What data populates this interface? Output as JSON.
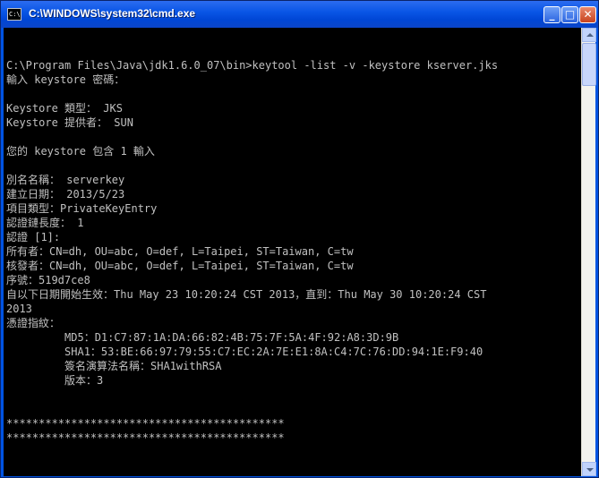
{
  "window": {
    "title": "C:\\WINDOWS\\system32\\cmd.exe",
    "icon_text": "C:\\",
    "buttons": {
      "minimize": "_",
      "maximize": "□",
      "close": "✕"
    }
  },
  "console": {
    "lines": [
      "",
      "C:\\Program Files\\Java\\jdk1.6.0_07\\bin>keytool -list -v -keystore kserver.jks",
      "輸入 keystore 密碼：",
      "",
      "Keystore 類型： JKS",
      "Keystore 提供者： SUN",
      "",
      "您的 keystore 包含 1 輸入",
      "",
      "別名名稱： serverkey",
      "建立日期： 2013/5/23",
      "項目類型：PrivateKeyEntry",
      "認證鏈長度： 1",
      "認證 [1]:",
      "所有者：CN=dh, OU=abc, O=def, L=Taipei, ST=Taiwan, C=tw",
      "核發者：CN=dh, OU=abc, O=def, L=Taipei, ST=Taiwan, C=tw",
      "序號：519d7ce8",
      "自以下日期開始生效：Thu May 23 10:20:24 CST 2013，直到：Thu May 30 10:20:24 CST",
      "2013",
      "憑證指紋：",
      "         MD5：D1:C7:87:1A:DA:66:82:4B:75:7F:5A:4F:92:A8:3D:9B",
      "         SHA1：53:BE:66:97:79:55:C7:EC:2A:7E:E1:8A:C4:7C:76:DD:94:1E:F9:40",
      "         簽名演算法名稱：SHA1withRSA",
      "         版本：3",
      "",
      "",
      "*******************************************",
      "*******************************************"
    ]
  }
}
